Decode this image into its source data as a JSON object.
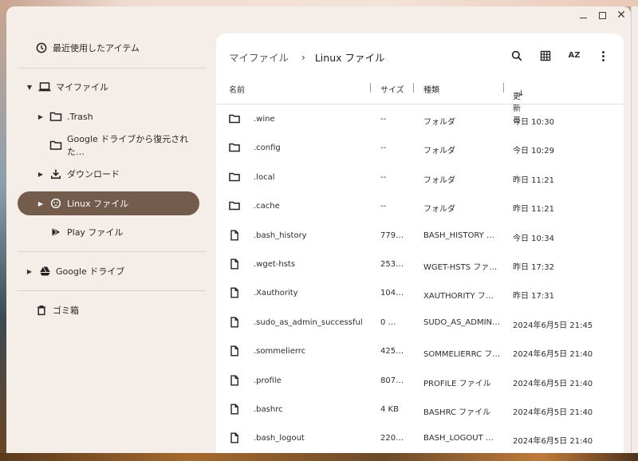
{
  "window": {
    "minimize": "minimize",
    "maximize": "maximize",
    "close": "close"
  },
  "sidebar": {
    "recent": {
      "label": "最近使用したアイテム",
      "icon": "clock-icon"
    },
    "my_files": {
      "label": "マイファイル",
      "icon": "laptop-icon"
    },
    "trash_folder": {
      "label": ".Trash",
      "icon": "folder-icon"
    },
    "gdrive_restored": {
      "label": "Google ドライブから復元された…",
      "icon": "folder-icon"
    },
    "downloads": {
      "label": "ダウンロード",
      "icon": "download-icon"
    },
    "linux_files": {
      "label": "Linux ファイル",
      "icon": "linux-penguin-icon"
    },
    "play_files": {
      "label": "Play ファイル",
      "icon": "play-store-icon"
    },
    "google_drive": {
      "label": "Google ドライブ",
      "icon": "google-drive-icon"
    },
    "trash": {
      "label": "ゴミ箱",
      "icon": "trash-icon"
    }
  },
  "breadcrumb": {
    "root": "マイファイル",
    "separator": "›",
    "current": "Linux ファイル"
  },
  "toolbar": {
    "search": "search-icon",
    "grid": "grid-view-icon",
    "sort": "sort-az-icon",
    "az_label": "AZ",
    "more": "more-vert-icon"
  },
  "columns": {
    "name": "名前",
    "size": "サイズ",
    "type": "種類",
    "date": "更新日",
    "sort_arrow": "↓"
  },
  "files": [
    {
      "name": ".wine",
      "size": "--",
      "type": "フォルダ",
      "date": "今日 10:30",
      "kind": "folder"
    },
    {
      "name": ".config",
      "size": "--",
      "type": "フォルダ",
      "date": "今日 10:29",
      "kind": "folder"
    },
    {
      "name": ".local",
      "size": "--",
      "type": "フォルダ",
      "date": "昨日 11:21",
      "kind": "folder"
    },
    {
      "name": ".cache",
      "size": "--",
      "type": "フォルダ",
      "date": "昨日 11:21",
      "kind": "folder"
    },
    {
      "name": ".bash_history",
      "size": "779…",
      "type": "BASH_HISTORY …",
      "date": "今日 10:34",
      "kind": "file"
    },
    {
      "name": ".wget-hsts",
      "size": "253…",
      "type": "WGET-HSTS ファ…",
      "date": "昨日 17:32",
      "kind": "file"
    },
    {
      "name": ".Xauthority",
      "size": "104…",
      "type": "XAUTHORITY フ…",
      "date": "昨日 17:31",
      "kind": "file"
    },
    {
      "name": ".sudo_as_admin_successful",
      "size": "0 …",
      "type": "SUDO_AS_ADMIN…",
      "date": "2024年6月5日 21:45",
      "kind": "file"
    },
    {
      "name": ".sommelierrc",
      "size": "425…",
      "type": "SOMMELIERRC フ…",
      "date": "2024年6月5日 21:40",
      "kind": "file"
    },
    {
      "name": ".profile",
      "size": "807…",
      "type": "PROFILE ファイル",
      "date": "2024年6月5日 21:40",
      "kind": "file"
    },
    {
      "name": ".bashrc",
      "size": "4 KB",
      "type": "BASHRC ファイル",
      "date": "2024年6月5日 21:40",
      "kind": "file"
    },
    {
      "name": ".bash_logout",
      "size": "220…",
      "type": "BASH_LOGOUT …",
      "date": "2024年6月5日 21:40",
      "kind": "file"
    }
  ],
  "colors": {
    "active_nav": "#735c4c",
    "window_bg": "#f5ede8",
    "panel_bg": "#ffffff"
  }
}
